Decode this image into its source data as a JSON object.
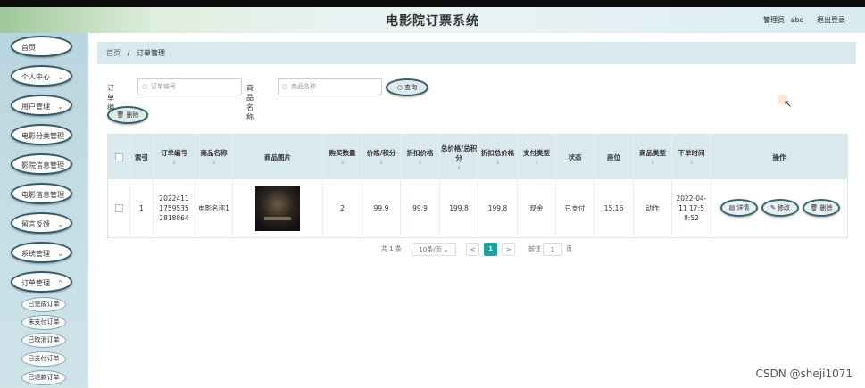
{
  "header": {
    "title": "电影院订票系统",
    "admin_label": "管理员",
    "username": "abo",
    "logout": "退出登录"
  },
  "sidebar": {
    "items": [
      {
        "label": "首页",
        "chevron": false
      },
      {
        "label": "个人中心",
        "chevron": true
      },
      {
        "label": "用户管理",
        "chevron": true
      },
      {
        "label": "电影分类管理",
        "chevron": false
      },
      {
        "label": "影院信息管理",
        "chevron": false
      },
      {
        "label": "电影信息管理",
        "chevron": false
      },
      {
        "label": "留言反馈",
        "chevron": true
      },
      {
        "label": "系统管理",
        "chevron": true
      },
      {
        "label": "订单管理",
        "chevron": true
      }
    ],
    "subitems": [
      "已完成订单",
      "未支付订单",
      "已取消订单",
      "已支付订单",
      "已退款订单"
    ]
  },
  "breadcrumb": {
    "home": "首页",
    "sep": "/",
    "current": "订单管理"
  },
  "filters": {
    "order_no_label": "订单编号",
    "order_no_placeholder": "订单编号",
    "goods_name_label": "商品名称",
    "goods_name_placeholder": "商品名称",
    "query_button": "查询",
    "delete_button": "删除"
  },
  "table": {
    "headers": [
      "索引",
      "订单编号",
      "商品名称",
      "商品图片",
      "购买数量",
      "价格/积分",
      "折扣价格",
      "总价格/总积分",
      "折扣总价格",
      "支付类型",
      "状态",
      "座位",
      "商品类型",
      "下单时间",
      "操作"
    ],
    "row": {
      "index": "1",
      "order_no": "202241117595352818864",
      "goods_name": "电影名称1",
      "quantity": "2",
      "price": "99.9",
      "discount_price": "99.9",
      "total": "199.8",
      "discount_total": "199.8",
      "pay_type": "现金",
      "status": "已支付",
      "seat": "15,16",
      "goods_type": "动作",
      "order_time": "2022-04-11 17:58:52"
    },
    "actions": [
      "详情",
      "修改",
      "删除"
    ]
  },
  "pager": {
    "total_text": "共 1 条",
    "page_size": "10条/页",
    "prev": "<",
    "page": "1",
    "next": ">",
    "goto_label": "前往",
    "goto_value": "1",
    "page_unit": "页"
  },
  "watermark": "CSDN @sheji1071",
  "colors": {
    "accent": "#1aa39b",
    "header_bg": "#d9e9ee",
    "sidebar_bg": "#c1dbe4"
  }
}
